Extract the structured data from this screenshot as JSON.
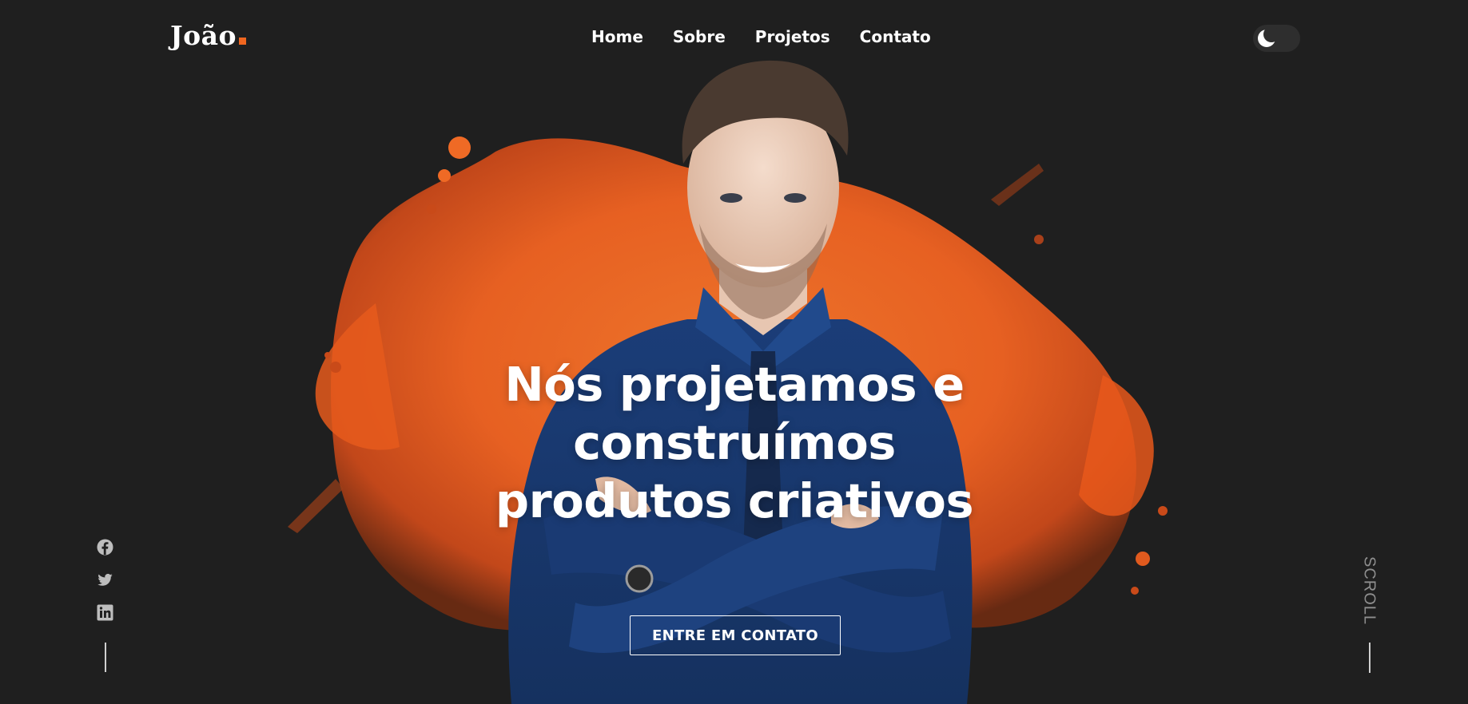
{
  "header": {
    "logo_text": "João",
    "nav": [
      {
        "label": "Home"
      },
      {
        "label": "Sobre"
      },
      {
        "label": "Projetos"
      },
      {
        "label": "Contato"
      }
    ],
    "theme_toggle_icon": "moon-icon"
  },
  "hero": {
    "title": "Nós projetamos e construímos produtos criativos",
    "cta_label": "ENTRE EM CONTATO",
    "image": "man-with-orange-paint-splash"
  },
  "social": [
    {
      "icon": "facebook-icon"
    },
    {
      "icon": "twitter-icon"
    },
    {
      "icon": "linkedin-icon"
    }
  ],
  "scroll_label": "SCROLL",
  "colors": {
    "background": "#1f1f1f",
    "accent": "#f0661f",
    "shirt": "#1c3f7d",
    "text": "#ffffff",
    "muted": "#8e8e8e"
  }
}
